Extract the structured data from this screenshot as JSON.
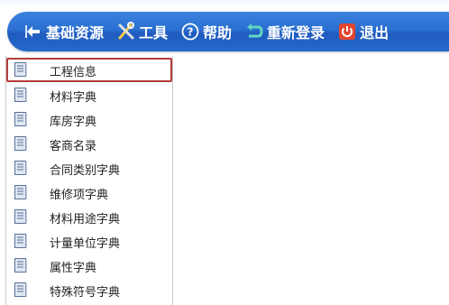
{
  "toolbar": {
    "items": [
      {
        "label": "基础资源",
        "icon": "resource-icon"
      },
      {
        "label": "工具",
        "icon": "tools-icon"
      },
      {
        "label": "帮助",
        "icon": "help-icon"
      },
      {
        "label": "重新登录",
        "icon": "relogin-icon"
      },
      {
        "label": "退出",
        "icon": "exit-icon"
      }
    ]
  },
  "menu": {
    "selected_index": 0,
    "items": [
      {
        "label": "工程信息",
        "icon": "document-icon"
      },
      {
        "label": "材料字典",
        "icon": "document-icon"
      },
      {
        "label": "库房字典",
        "icon": "document-icon"
      },
      {
        "label": "客商名录",
        "icon": "document-icon"
      },
      {
        "label": "合同类别字典",
        "icon": "document-icon"
      },
      {
        "label": "维修项字典",
        "icon": "document-icon"
      },
      {
        "label": "材料用途字典",
        "icon": "document-icon"
      },
      {
        "label": "计量单位字典",
        "icon": "document-icon"
      },
      {
        "label": "属性字典",
        "icon": "document-icon"
      },
      {
        "label": "特殊符号字典",
        "icon": "document-icon"
      }
    ]
  },
  "colors": {
    "toolbar_blue": "#2a6fd1",
    "selection_border": "#b53b3b",
    "exit_red": "#e2452f"
  }
}
